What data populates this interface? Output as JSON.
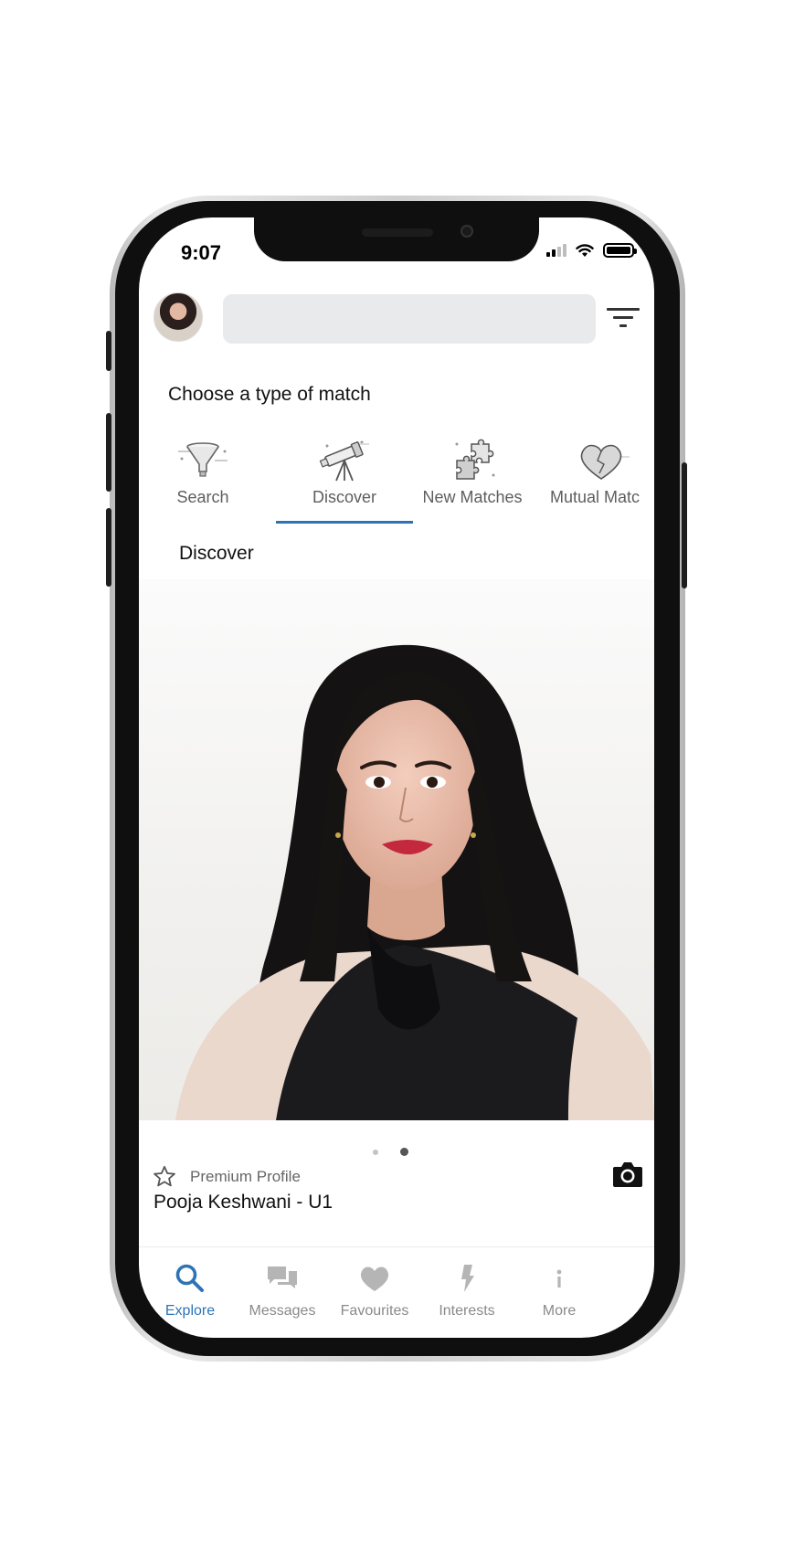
{
  "status_bar": {
    "time": "9:07"
  },
  "header": {
    "search_value": "",
    "search_placeholder": ""
  },
  "match_types": {
    "title": "Choose a type of match",
    "tabs": [
      {
        "label": "Search",
        "icon": "funnel-icon"
      },
      {
        "label": "Discover",
        "icon": "telescope-icon"
      },
      {
        "label": "New Matches",
        "icon": "puzzle-icon"
      },
      {
        "label": "Mutual Matc",
        "icon": "heart-icon"
      }
    ],
    "active_tab": "Discover"
  },
  "content": {
    "section_title": "Discover"
  },
  "profile_card": {
    "badge": "Premium Profile",
    "name": "Pooja Keshwani - U1",
    "photo_count": 2,
    "active_photo_index": 2
  },
  "bottom_nav": {
    "items": [
      {
        "label": "Explore",
        "icon": "search-icon"
      },
      {
        "label": "Messages",
        "icon": "chat-icon"
      },
      {
        "label": "Favourites",
        "icon": "heart-icon"
      },
      {
        "label": "Interests",
        "icon": "bolt-icon"
      },
      {
        "label": "More",
        "icon": "info-icon"
      }
    ],
    "active": "Explore"
  },
  "colors": {
    "accent": "#2e74b5",
    "inactive": "#8a8a8a",
    "search_bg": "#e9eaeb"
  }
}
